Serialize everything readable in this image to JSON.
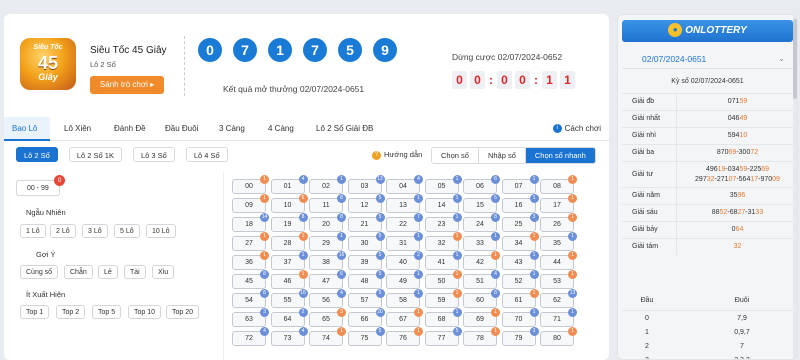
{
  "header": {
    "logo_line1": "Siêu Tốc",
    "logo_line2": "45",
    "logo_line3": "Giây",
    "game_title": "Siêu Tốc 45 Giây",
    "game_sub": "Lô 2 Số",
    "play_button": "Sảnh trò chơi ▸",
    "balls": [
      "0",
      "7",
      "1",
      "7",
      "5",
      "9"
    ],
    "result_text": "Kết quả mở thưởng 02/07/2024-0651",
    "next_label": "Dừng cược 02/07/2024-0652",
    "countdown": [
      "0",
      "0",
      "0",
      "0",
      "1",
      "1"
    ]
  },
  "tabs": [
    {
      "label": "Bao Lô",
      "active": true
    },
    {
      "label": "Lô Xiên"
    },
    {
      "label": "Đánh Đề"
    },
    {
      "label": "Đầu Đuôi"
    },
    {
      "label": "3 Càng"
    },
    {
      "label": "4 Càng"
    },
    {
      "label": "Lô 2 Số Giải ĐB"
    }
  ],
  "how_to_play": "Cách chơi",
  "subtabs": [
    {
      "label": "Lô 2 Số",
      "active": true
    },
    {
      "label": "Lô 2 Số 1K"
    },
    {
      "label": "Lô 3 Số"
    },
    {
      "label": "Lô 4 Số"
    }
  ],
  "guide_label": "Hướng dẫn",
  "modes": [
    {
      "label": "Chọn số"
    },
    {
      "label": "Nhập số"
    },
    {
      "label": "Chọn số nhanh",
      "active": true
    }
  ],
  "filters": {
    "range_button": "00 - 99",
    "range_badge": "0",
    "random_label": "Ngẫu Nhiên",
    "random_buttons": [
      "1 Lô",
      "2 Lô",
      "3 Lô",
      "5 Lô",
      "10 Lô"
    ],
    "suggest_label": "Gợi Ý",
    "suggest_buttons": [
      "Cùng số",
      "Chẵn",
      "Lẻ",
      "Tài",
      "Xỉu"
    ],
    "rare_label": "Ít Xuất Hiện",
    "rare_buttons": [
      "Top 1",
      "Top 2",
      "Top 5",
      "Top 10",
      "Top 20"
    ]
  },
  "grid": [
    {
      "n": "00",
      "b": "1",
      "c": "orange"
    },
    {
      "n": "01",
      "b": "4",
      "c": "blue"
    },
    {
      "n": "02",
      "b": "1",
      "c": "blue"
    },
    {
      "n": "03",
      "b": "13",
      "c": "blue"
    },
    {
      "n": "04",
      "b": "4",
      "c": "blue"
    },
    {
      "n": "05",
      "b": "1",
      "c": "blue"
    },
    {
      "n": "06",
      "b": "6",
      "c": "blue"
    },
    {
      "n": "07",
      "b": "1",
      "c": "blue"
    },
    {
      "n": "08",
      "b": "1",
      "c": "orange"
    },
    {
      "n": "09",
      "b": "1",
      "c": "orange"
    },
    {
      "n": "10",
      "b": "6",
      "c": "orange"
    },
    {
      "n": "11",
      "b": "8",
      "c": "blue"
    },
    {
      "n": "12",
      "b": "5",
      "c": "blue"
    },
    {
      "n": "13",
      "b": "1",
      "c": "blue"
    },
    {
      "n": "14",
      "b": "1",
      "c": "blue"
    },
    {
      "n": "15",
      "b": "5",
      "c": "blue"
    },
    {
      "n": "16",
      "b": "1",
      "c": "blue"
    },
    {
      "n": "17",
      "b": "1",
      "c": "orange"
    },
    {
      "n": "18",
      "b": "14",
      "c": "blue"
    },
    {
      "n": "19",
      "b": "8",
      "c": "blue"
    },
    {
      "n": "20",
      "b": "8",
      "c": "blue"
    },
    {
      "n": "21",
      "b": "5",
      "c": "blue"
    },
    {
      "n": "22",
      "b": "7",
      "c": "blue"
    },
    {
      "n": "23",
      "b": "1",
      "c": "blue"
    },
    {
      "n": "24",
      "b": "8",
      "c": "blue"
    },
    {
      "n": "25",
      "b": "3",
      "c": "blue"
    },
    {
      "n": "26",
      "b": "1",
      "c": "orange"
    },
    {
      "n": "27",
      "b": "1",
      "c": "orange"
    },
    {
      "n": "28",
      "b": "1",
      "c": "orange"
    },
    {
      "n": "29",
      "b": "1",
      "c": "blue"
    },
    {
      "n": "30",
      "b": "5",
      "c": "blue"
    },
    {
      "n": "31",
      "b": "1",
      "c": "blue"
    },
    {
      "n": "32",
      "b": "1",
      "c": "orange"
    },
    {
      "n": "33",
      "b": "1",
      "c": "blue"
    },
    {
      "n": "34",
      "b": "1",
      "c": "orange"
    },
    {
      "n": "35",
      "b": "1",
      "c": "blue"
    },
    {
      "n": "36",
      "b": "1",
      "c": "orange"
    },
    {
      "n": "37",
      "b": "1",
      "c": "blue"
    },
    {
      "n": "38",
      "b": "16",
      "c": "blue"
    },
    {
      "n": "39",
      "b": "5",
      "c": "blue"
    },
    {
      "n": "40",
      "b": "2",
      "c": "blue"
    },
    {
      "n": "41",
      "b": "1",
      "c": "blue"
    },
    {
      "n": "42",
      "b": "1",
      "c": "orange"
    },
    {
      "n": "43",
      "b": "1",
      "c": "blue"
    },
    {
      "n": "44",
      "b": "1",
      "c": "orange"
    },
    {
      "n": "45",
      "b": "8",
      "c": "blue"
    },
    {
      "n": "46",
      "b": "1",
      "c": "orange"
    },
    {
      "n": "47",
      "b": "6",
      "c": "blue"
    },
    {
      "n": "48",
      "b": "5",
      "c": "blue"
    },
    {
      "n": "49",
      "b": "1",
      "c": "blue"
    },
    {
      "n": "50",
      "b": "1",
      "c": "orange"
    },
    {
      "n": "51",
      "b": "4",
      "c": "blue"
    },
    {
      "n": "52",
      "b": "1",
      "c": "blue"
    },
    {
      "n": "53",
      "b": "1",
      "c": "orange"
    },
    {
      "n": "54",
      "b": "8",
      "c": "blue"
    },
    {
      "n": "55",
      "b": "16",
      "c": "blue"
    },
    {
      "n": "56",
      "b": "4",
      "c": "blue"
    },
    {
      "n": "57",
      "b": "5",
      "c": "blue"
    },
    {
      "n": "58",
      "b": "1",
      "c": "blue"
    },
    {
      "n": "59",
      "b": "1",
      "c": "orange"
    },
    {
      "n": "60",
      "b": "8",
      "c": "blue"
    },
    {
      "n": "61",
      "b": "1",
      "c": "orange"
    },
    {
      "n": "62",
      "b": "13",
      "c": "blue"
    },
    {
      "n": "63",
      "b": "3",
      "c": "blue"
    },
    {
      "n": "64",
      "b": "2",
      "c": "blue"
    },
    {
      "n": "65",
      "b": "3",
      "c": "orange"
    },
    {
      "n": "66",
      "b": "20",
      "c": "blue"
    },
    {
      "n": "67",
      "b": "1",
      "c": "orange"
    },
    {
      "n": "68",
      "b": "1",
      "c": "blue"
    },
    {
      "n": "69",
      "b": "1",
      "c": "orange"
    },
    {
      "n": "70",
      "b": "1",
      "c": "blue"
    },
    {
      "n": "71",
      "b": "1",
      "c": "blue"
    },
    {
      "n": "72",
      "b": "4",
      "c": "blue"
    },
    {
      "n": "73",
      "b": "4",
      "c": "blue"
    },
    {
      "n": "74",
      "b": "1",
      "c": "orange"
    },
    {
      "n": "75",
      "b": "5",
      "c": "blue"
    },
    {
      "n": "76",
      "b": "1",
      "c": "orange"
    },
    {
      "n": "77",
      "b": "5",
      "c": "blue"
    },
    {
      "n": "78",
      "b": "1",
      "c": "orange"
    },
    {
      "n": "79",
      "b": "3",
      "c": "blue"
    },
    {
      "n": "80",
      "b": "1",
      "c": "orange"
    }
  ],
  "right": {
    "brand": "ONLOTTERY",
    "date": "02/07/2024-0651",
    "ky": "Kỳ số 02/07/2024-0651",
    "prizes": [
      {
        "name": "Giải đb",
        "value": [
          [
            "071",
            "7"
          ],
          [
            "59",
            "o"
          ]
        ]
      },
      {
        "name": "Giải nhất",
        "value": [
          [
            "046",
            "7"
          ],
          [
            "49",
            "o"
          ]
        ]
      },
      {
        "name": "Giải nhì",
        "value": [
          [
            "594",
            "7"
          ],
          [
            "10",
            "o"
          ]
        ]
      },
      {
        "name": "Giải ba",
        "value": [
          [
            "870",
            "7"
          ],
          [
            "69",
            "o"
          ],
          [
            "-300",
            "7"
          ],
          [
            "72",
            "o"
          ]
        ]
      },
      {
        "name": "Giải tư",
        "value": [
          [
            "496",
            "7"
          ],
          [
            "19",
            "o"
          ],
          [
            "-034",
            "7"
          ],
          [
            "59",
            "o"
          ],
          [
            "-225",
            "7"
          ],
          [
            "69",
            "o"
          ]
        ],
        "value2": [
          [
            "297",
            "7"
          ],
          [
            "32",
            "o"
          ],
          [
            "-271",
            "7"
          ],
          [
            "07",
            "o"
          ],
          [
            "-564",
            "7"
          ],
          [
            "17",
            "o"
          ],
          [
            "-970",
            "7"
          ],
          [
            "09",
            "o"
          ]
        ]
      },
      {
        "name": "Giải năm",
        "value": [
          [
            "35",
            "7"
          ],
          [
            "96",
            "o"
          ]
        ]
      },
      {
        "name": "Giải sáu",
        "value": [
          [
            "88",
            "7"
          ],
          [
            "52",
            "o"
          ],
          [
            "-68",
            "7"
          ],
          [
            "27",
            "o"
          ],
          [
            "-31",
            "7"
          ],
          [
            "33",
            "o"
          ]
        ]
      },
      {
        "name": "Giải bảy",
        "value": [
          [
            "0",
            "7"
          ],
          [
            "64",
            "o"
          ]
        ]
      },
      {
        "name": "Giải tám",
        "value": [
          [
            "32",
            "o"
          ]
        ]
      }
    ],
    "loto_head": {
      "dau": "Đầu",
      "duoi": "Đuôi"
    },
    "loto_rows": [
      {
        "dau": "0",
        "duoi": "7,9"
      },
      {
        "dau": "1",
        "duoi": "0,9,7"
      },
      {
        "dau": "2",
        "duoi": "7"
      },
      {
        "dau": "3",
        "duoi": "2,3,2"
      }
    ]
  }
}
